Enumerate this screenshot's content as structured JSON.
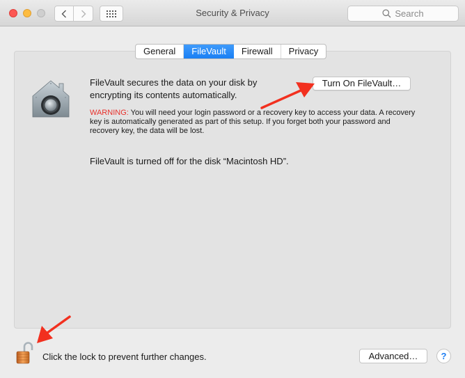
{
  "window": {
    "title": "Security & Privacy",
    "search_placeholder": "Search",
    "nav_back_icon": "chevron-left-icon",
    "nav_forward_icon": "chevron-right-icon",
    "show_all_icon": "grid-icon"
  },
  "tabs": [
    {
      "label": "General",
      "active": false
    },
    {
      "label": "FileVault",
      "active": true
    },
    {
      "label": "Firewall",
      "active": false
    },
    {
      "label": "Privacy",
      "active": false
    }
  ],
  "filevault": {
    "icon": "filevault-house-icon",
    "description": "FileVault secures the data on your disk by encrypting its contents automatically.",
    "turn_on_button": "Turn On FileVault…",
    "warning_label": "WARNING:",
    "warning_text": " You will need your login password or a recovery key to access your data. A recovery key is automatically generated as part of this setup. If you forget both your password and recovery key, the data will be lost.",
    "status": "FileVault is turned off for the disk “Macintosh HD”."
  },
  "footer": {
    "lock_icon": "unlocked-padlock-icon",
    "lock_text": "Click the lock to prevent further changes.",
    "advanced_button": "Advanced…",
    "help_button": "?"
  },
  "annotations": {
    "arrow_color": "#f2301f",
    "arrows": [
      "points-to-turn-on-filevault-button",
      "points-to-lock-icon"
    ]
  },
  "colors": {
    "accent": "#1a7ff4",
    "warning": "#e8302b",
    "close": "#fc5753",
    "minimize": "#fdbc40"
  }
}
